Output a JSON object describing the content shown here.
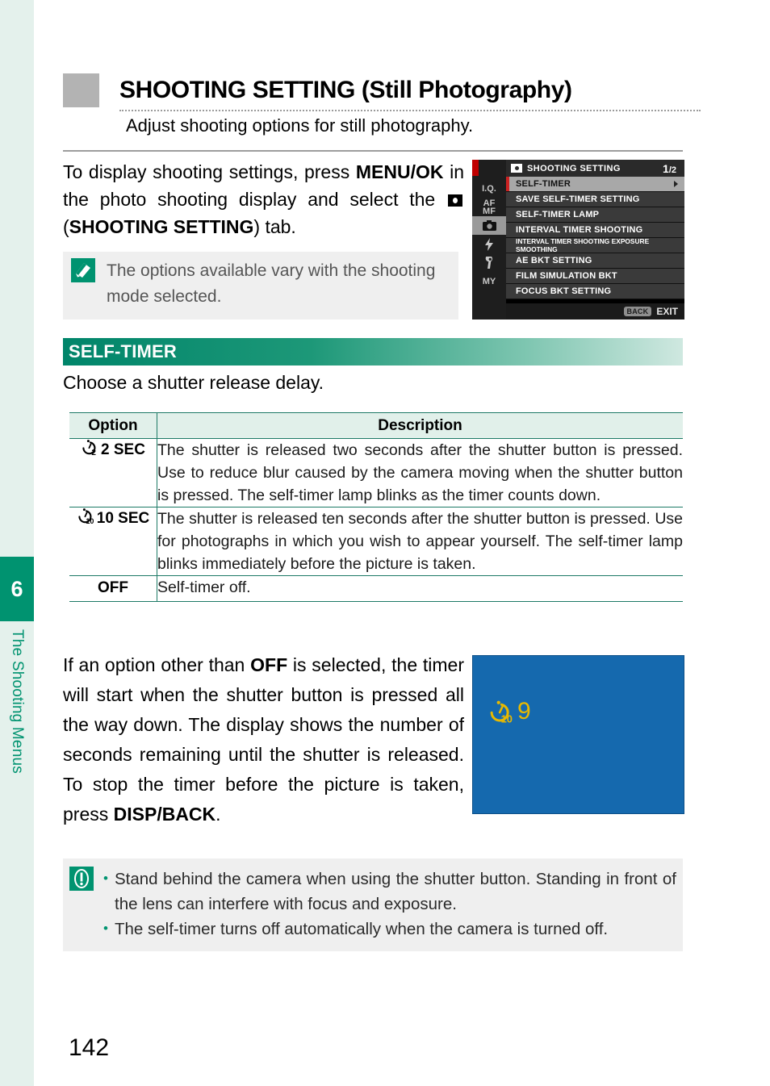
{
  "sidebar": {
    "chapter_number": "6",
    "chapter_title": "The Shooting Menus",
    "accent_color": "#009370",
    "strip_color": "#e4f1ec"
  },
  "header": {
    "title": "SHOOTING SETTING (Still Photography)",
    "subtitle": "Adjust shooting options for still photography."
  },
  "intro": {
    "line1": "To display shooting settings, press ",
    "bold1": "MENU/OK",
    "line2": " in the photo shooting display and select the ",
    "icon": "camera-shooting-setting-icon",
    "line3": " (",
    "bold2": "SHOOTING SETTING",
    "line4": ") tab."
  },
  "tip_note": {
    "icon": "note-pencil-icon",
    "text": "The options available vary with the shooting mode selected."
  },
  "camera_menu": {
    "header_icon": "camera-icon",
    "header_title": "SHOOTING SETTING",
    "page_current": "1",
    "page_total": "/2",
    "tabs": [
      {
        "label": "I.Q.",
        "selected": false
      },
      {
        "label": "AF\nMF",
        "selected": false
      },
      {
        "label": "camera-icon",
        "selected": true
      },
      {
        "label": "flash-icon",
        "selected": false
      },
      {
        "label": "wrench-icon",
        "selected": false
      },
      {
        "label": "MY",
        "selected": false
      }
    ],
    "items": [
      {
        "label": "SELF-TIMER",
        "selected": true,
        "has_arrow": true,
        "tiny": false
      },
      {
        "label": "SAVE SELF-TIMER SETTING",
        "selected": false,
        "has_arrow": false,
        "tiny": false
      },
      {
        "label": "SELF-TIMER LAMP",
        "selected": false,
        "has_arrow": false,
        "tiny": false
      },
      {
        "label": "INTERVAL TIMER SHOOTING",
        "selected": false,
        "has_arrow": false,
        "tiny": false
      },
      {
        "label": "INTERVAL TIMER SHOOTING EXPOSURE SMOOTHING",
        "selected": false,
        "has_arrow": false,
        "tiny": true
      },
      {
        "label": "AE BKT SETTING",
        "selected": false,
        "has_arrow": false,
        "tiny": false
      },
      {
        "label": "FILM SIMULATION BKT",
        "selected": false,
        "has_arrow": false,
        "tiny": false
      },
      {
        "label": "FOCUS BKT SETTING",
        "selected": false,
        "has_arrow": false,
        "tiny": false
      }
    ],
    "footer": {
      "back_chip": "BACK",
      "exit_label": "EXIT"
    }
  },
  "section": {
    "heading": "SELF-TIMER",
    "description": "Choose a shutter release delay."
  },
  "table": {
    "columns": [
      "Option",
      "Description"
    ],
    "rows": [
      {
        "icon": "self-timer-2sec-icon",
        "option": "2 SEC",
        "description": "The shutter is released two seconds after the shutter button is pressed. Use to reduce blur caused by the camera moving when the shutter button is pressed. The self-timer lamp blinks as the timer counts down."
      },
      {
        "icon": "self-timer-10sec-icon",
        "option": "10 SEC",
        "description": "The shutter is released ten seconds after the shutter button is pressed. Use for photographs in which you wish to appear yourself. The self-timer lamp blinks immediately before the picture is taken."
      },
      {
        "icon": "",
        "option": "OFF",
        "description": "Self-timer off."
      }
    ]
  },
  "lower_paragraph": {
    "part1": "If an option other than ",
    "bold1": "OFF",
    "part2": " is selected, the timer will start when the shutter button is pressed all the way down. The display shows the number of seconds remaining until the shutter is released. To stop the timer before the picture is taken, press ",
    "bold2": "DISP/BACK",
    "part3": "."
  },
  "blue_display": {
    "background_color": "#1569ae",
    "icon": "self-timer-10sec-icon",
    "countdown": "9"
  },
  "caution_note": {
    "icon": "caution-exclamation-icon",
    "bullets": [
      "Stand behind the camera when using the shutter button. Standing in front of the lens can interfere with focus and exposure.",
      "The self-timer turns off automatically when the camera is turned off."
    ]
  },
  "footer": {
    "page_number": "142"
  }
}
